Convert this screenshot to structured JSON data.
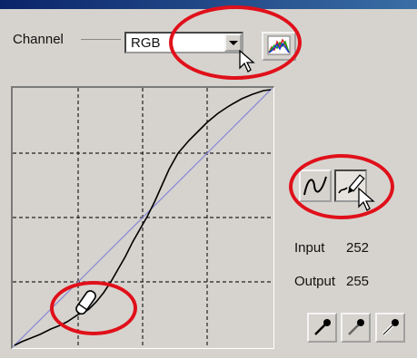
{
  "channel": {
    "label": "Channel",
    "value": "RGB",
    "dropdown_icon": "chevron-down-icon",
    "rgb_button_icon": "rgb-histogram-icon"
  },
  "curve": {
    "grid": "4x4 dashed",
    "control_icon": "curve-point-handle-icon"
  },
  "tools": {
    "curve_tool_icon": "smooth-curve-icon",
    "pencil_tool_icon": "freehand-pencil-icon",
    "pencil_tool_pressed": true
  },
  "readout": {
    "input_label": "Input",
    "input_value": "252",
    "output_label": "Output",
    "output_value": "255"
  },
  "droppers": [
    "black-point-eyedropper-icon",
    "gray-point-eyedropper-icon",
    "white-point-eyedropper-icon"
  ],
  "highlight_color": "#e0101a",
  "accent_title_color": "#0a246a"
}
